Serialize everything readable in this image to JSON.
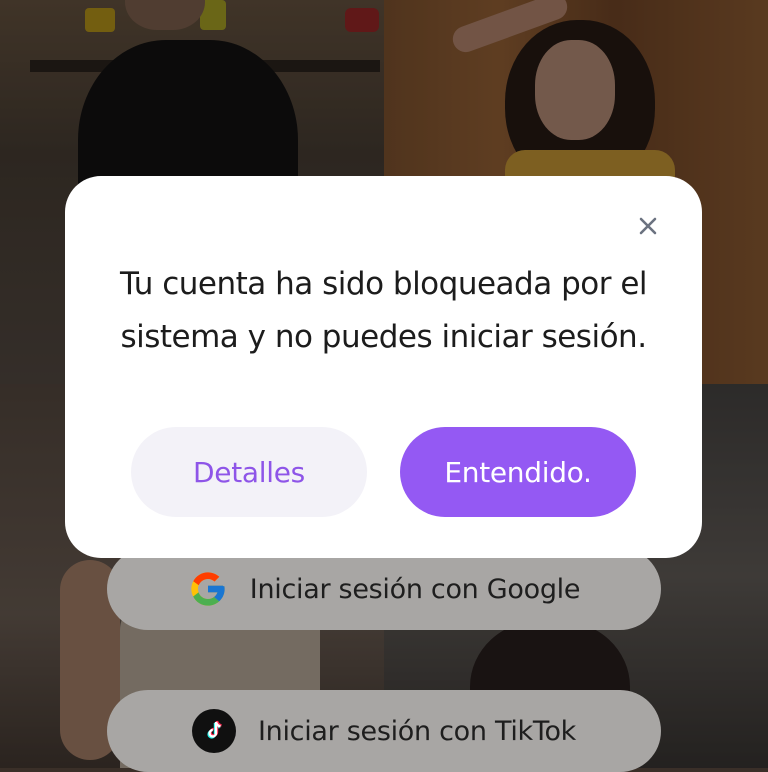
{
  "modal": {
    "message": "Tu cuenta ha sido bloqueada por el sistema y no puedes iniciar sesión.",
    "close_icon": "close-icon",
    "details_label": "Detalles",
    "ok_label": "Entendido.",
    "colors": {
      "accent": "#9459f3",
      "details_bg": "#f3f2f8",
      "details_text": "#8e55e8"
    }
  },
  "login": {
    "google_label": "Iniciar sesión con Google",
    "google_icon": "google-icon",
    "tiktok_label": "Iniciar sesión con TikTok",
    "tiktok_icon": "tiktok-icon"
  }
}
